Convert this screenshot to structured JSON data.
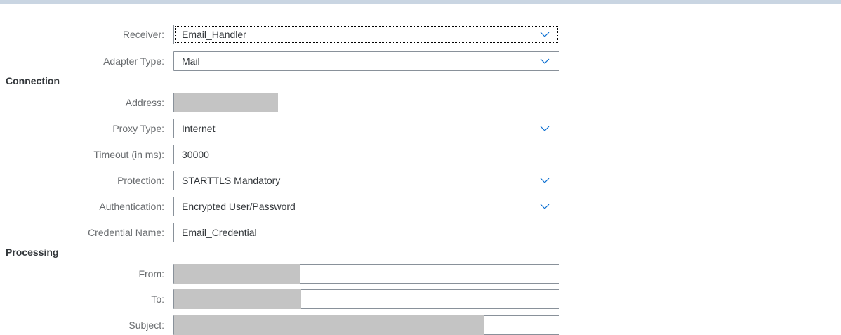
{
  "sections": {
    "connection": "Connection",
    "processing": "Processing"
  },
  "fields": {
    "receiver": {
      "label": "Receiver:",
      "value": "Email_Handler"
    },
    "adapter_type": {
      "label": "Adapter Type:",
      "value": "Mail"
    },
    "address": {
      "label": "Address:",
      "value": ""
    },
    "proxy_type": {
      "label": "Proxy Type:",
      "value": "Internet"
    },
    "timeout": {
      "label": "Timeout (in ms):",
      "value": "30000"
    },
    "protection": {
      "label": "Protection:",
      "value": "STARTTLS Mandatory"
    },
    "authentication": {
      "label": "Authentication:",
      "value": "Encrypted User/Password"
    },
    "credential_name": {
      "label": "Credential Name:",
      "value": "Email_Credential"
    },
    "from": {
      "label": "From:",
      "value": ""
    },
    "to": {
      "label": "To:",
      "value": ""
    },
    "subject": {
      "label": "Subject:",
      "value": ""
    }
  },
  "icons": {
    "dropdown": "chevron-down-icon"
  },
  "colors": {
    "top_bar": "#c9d5e2",
    "label": "#6a6d70",
    "border": "#89919a",
    "accent": "#0a6ed1",
    "redaction": "#c4c4c4"
  }
}
